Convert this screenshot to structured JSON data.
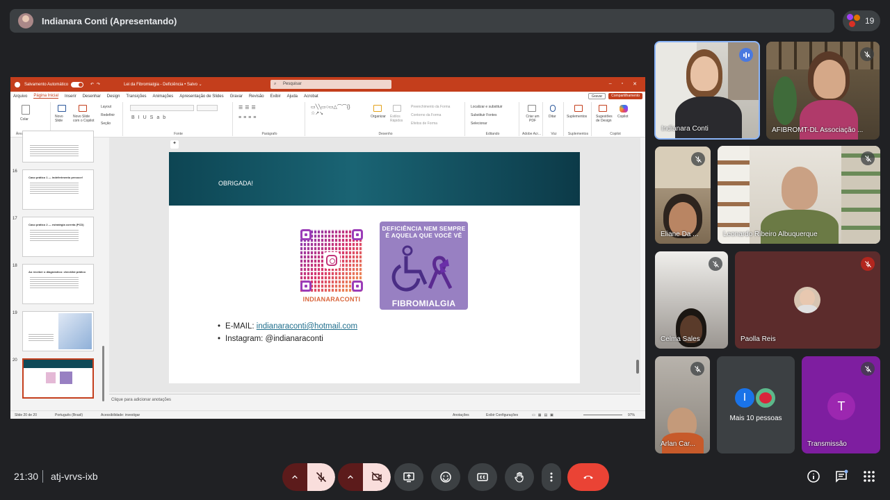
{
  "meet": {
    "presenter_label": "Indianara Conti (Apresentando)",
    "participant_count": "19",
    "time": "21:30",
    "meeting_code": "atj-vrvs-ixb",
    "more_people_label": "Mais 10 pessoas",
    "avatar_i": "I",
    "avatar_t": "T"
  },
  "participants": [
    {
      "name": "Indianara Conti"
    },
    {
      "name": "AFIBROMT-DL Associação ..."
    },
    {
      "name": "Eliane Da ..."
    },
    {
      "name": "Leonardo Ribeiro Albuquerque"
    },
    {
      "name": "Celma Sales"
    },
    {
      "name": "Paolla Reis"
    },
    {
      "name": "Arlan Car..."
    },
    {
      "name": "Transmissão"
    }
  ],
  "ppt": {
    "autosave": "Salvamento Automático",
    "doc_title": "Lei da Fibromialgia - Deficiência • Salvo ⌄",
    "search": "Pesquisar",
    "menu": [
      "Arquivo",
      "Página Inicial",
      "Inserir",
      "Desenhar",
      "Design",
      "Transições",
      "Animações",
      "Apresentação de Slides",
      "Gravar",
      "Revisão",
      "Exibir",
      "Ajuda",
      "Acrobat"
    ],
    "record_btn": "Gravar",
    "share_btn": "Compartilhamento",
    "groups": [
      "Área de Transfer...",
      "Slides",
      "Fonte",
      "Parágrafo",
      "Desenho",
      "Editando",
      "Adobe Acr...",
      "Voz",
      "Suplementos",
      "Copilot"
    ],
    "ribbon_labels": {
      "paste": "Colar",
      "new_slide": "Novo Slide",
      "new_slide_copilot": "Novo Slide com o Copilot",
      "layout": "Layout",
      "reset": "Redefinir",
      "section": "Seção",
      "arrange": "Organizar",
      "quick_styles": "Estilos Rápidos",
      "fill": "Preenchimento da Forma",
      "outline": "Contorno da Forma",
      "effects": "Efeitos de Forma",
      "find": "Localizar e substituir",
      "replace_fonts": "Substituir Fontes",
      "select": "Selecionar",
      "create_pdf": "Criar um PDF",
      "dictate": "Ditar",
      "addins": "Suplementos",
      "design_ideas": "Sugestões de Design",
      "copilot": "Copilot"
    },
    "thumbs": [
      {
        "num": "",
        "title": ""
      },
      {
        "num": "16",
        "title": "Caso prático 1 — indeferimento precoce!"
      },
      {
        "num": "17",
        "title": "Caso prático 2 — estratégia correta (PCD)"
      },
      {
        "num": "18",
        "title": "Ao receber o diagnóstico: checklist prático"
      },
      {
        "num": "19",
        "title": ""
      },
      {
        "num": "20",
        "title": "Obrigada"
      }
    ],
    "slide": {
      "header": "OBRIGADA!",
      "qr_label": "INDIANARACONTI",
      "badge_top": "DEFICIÊNCIA NEM SEMPRE É AQUELA QUE VOCÊ VÊ",
      "badge_bottom": "FIBROMIALGIA",
      "email_label": "E-MAIL:",
      "email": "indianaraconti@hotmail.com",
      "instagram": "Instagram: @indianaraconti"
    },
    "notes": "Clique para adicionar anotações",
    "status": {
      "slide": "Slide 20 de 20",
      "lang": "Português (Brasil)",
      "access": "Acessibilidade: investigar",
      "notes": "Anotações",
      "display": "Exibir Configurações",
      "zoom": "97%"
    }
  }
}
